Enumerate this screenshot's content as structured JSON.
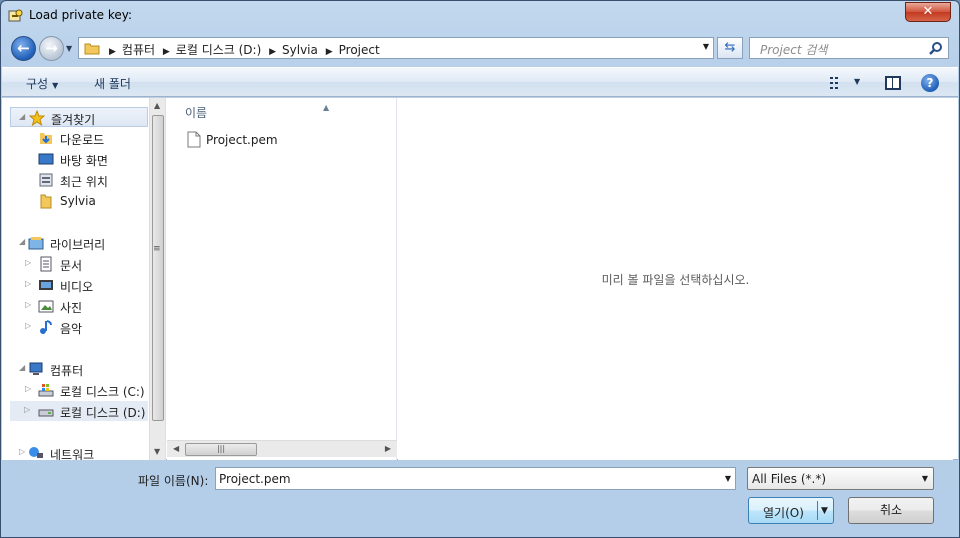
{
  "window": {
    "title": "Load private key:"
  },
  "address": {
    "crumbs": [
      "컴퓨터",
      "로컬 디스크 (D:)",
      "Sylvia",
      "Project"
    ],
    "search_placeholder": "Project 검색"
  },
  "toolbar": {
    "organize_label": "구성",
    "new_folder_label": "새 폴더"
  },
  "navigation": {
    "favorites": {
      "label": "즐겨찾기",
      "items": [
        "다운로드",
        "바탕 화면",
        "최근 위치",
        "Sylvia"
      ]
    },
    "libraries": {
      "label": "라이브러리",
      "items": [
        "문서",
        "비디오",
        "사진",
        "음악"
      ]
    },
    "computer": {
      "label": "컴퓨터",
      "items": [
        "로컬 디스크 (C:)",
        "로컬 디스크 (D:)"
      ]
    },
    "network": {
      "label": "네트워크"
    }
  },
  "file_list": {
    "column_name": "이름",
    "files": [
      {
        "name": "Project.pem"
      }
    ]
  },
  "preview": {
    "message": "미리 볼 파일을 선택하십시오."
  },
  "bottom": {
    "file_name_label": "파일 이름(N):",
    "file_name_value": "Project.pem",
    "filter_value": "All Files (*.*)",
    "open_label": "열기(O)",
    "cancel_label": "취소"
  },
  "colors": {
    "accent": "#3c7fb1",
    "title_bar": "#b8d0ea",
    "close": "#c23a1f"
  }
}
